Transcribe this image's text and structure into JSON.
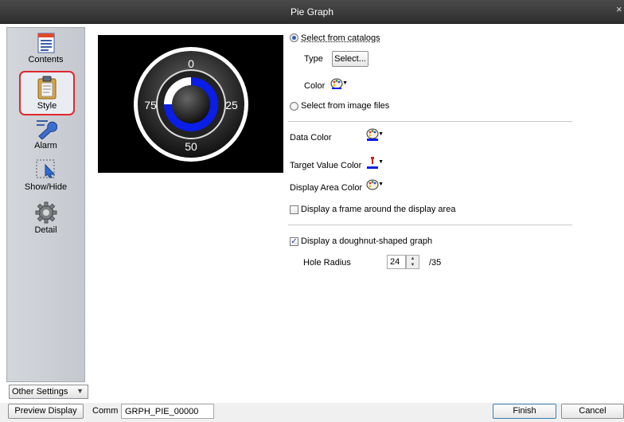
{
  "window": {
    "title": "Pie Graph",
    "close_glyph": "×"
  },
  "sidebar": {
    "items": [
      {
        "label": "Contents",
        "icon": "contents-icon"
      },
      {
        "label": "Style",
        "icon": "style-icon",
        "active": true
      },
      {
        "label": "Alarm",
        "icon": "wrench-icon"
      },
      {
        "label": "Show/Hide",
        "icon": "show-hide-icon"
      },
      {
        "label": "Detail",
        "icon": "gear-icon"
      }
    ],
    "other_settings": "Other Settings"
  },
  "preview": {
    "gauge_labels": {
      "top": "0",
      "right": "25",
      "bottom": "50",
      "left": "75"
    },
    "fill_fraction": 0.75,
    "data_color": "#0a1ee6"
  },
  "style": {
    "select_catalogs": "Select from catalogs",
    "type_label": "Type",
    "select_button": "Select...",
    "color_label": "Color",
    "select_image_files": "Select from image files",
    "data_color_label": "Data Color",
    "target_value_color_label": "Target Value Color",
    "display_area_color_label": "Display Area Color",
    "display_frame_label": "Display a frame around the display area",
    "doughnut_label": "Display a doughnut-shaped graph",
    "hole_radius_label": "Hole Radius",
    "hole_radius_value": "24",
    "hole_radius_max": "/35"
  },
  "bottom": {
    "preview_display": "Preview Display",
    "comm_label": "Comm",
    "comm_value": "GRPH_PIE_00000",
    "finish": "Finish",
    "cancel": "Cancel"
  }
}
